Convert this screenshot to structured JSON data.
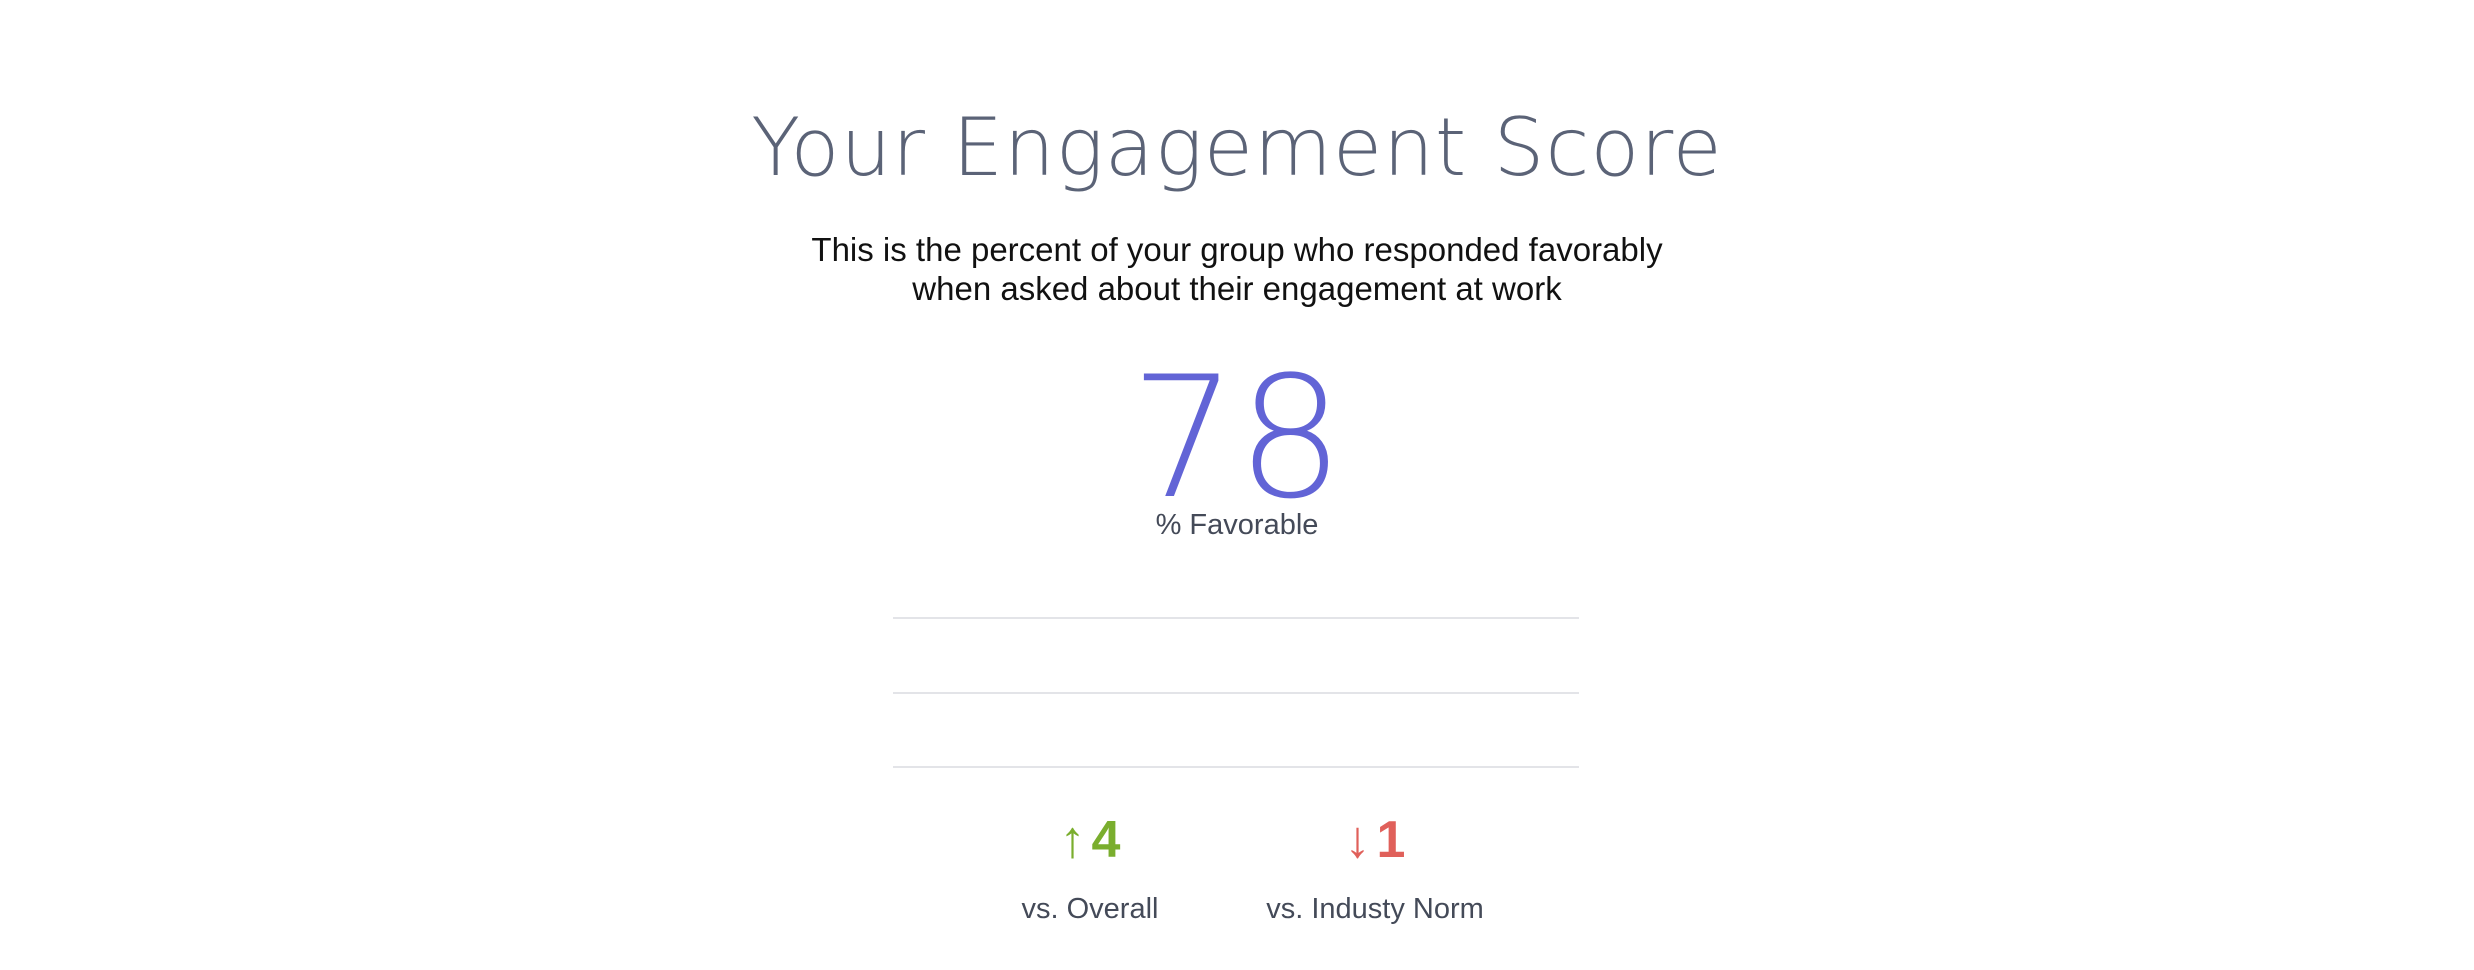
{
  "header": {
    "title": "Your Engagement Score",
    "subtitle_line1": "This is the percent of your group who responded favorably",
    "subtitle_line2": "when asked about their engagement at work"
  },
  "score": {
    "value": "78",
    "label": "% Favorable",
    "color": "#6264d6"
  },
  "comparisons": [
    {
      "direction": "up",
      "arrow": "↑",
      "icon": "arrow-up-icon",
      "value": "4",
      "label": "vs. Overall",
      "color": "#7aae2e"
    },
    {
      "direction": "down",
      "arrow": "↓",
      "icon": "arrow-down-icon",
      "value": "1",
      "label": "vs. Industy Norm",
      "color": "#e0605a"
    }
  ]
}
